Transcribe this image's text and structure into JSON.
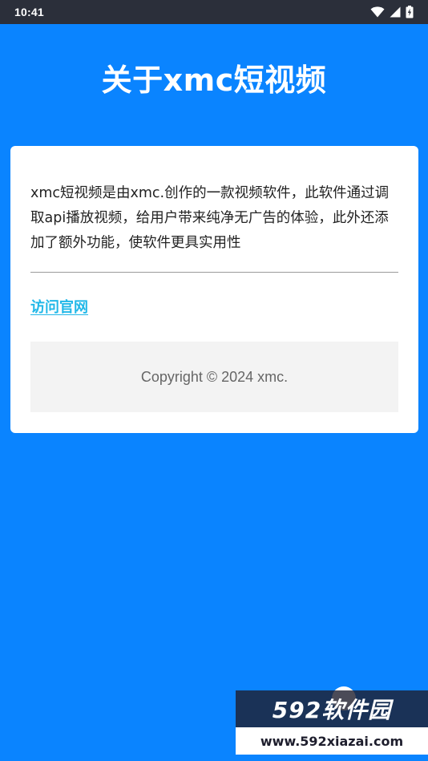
{
  "status_bar": {
    "time": "10:41",
    "icons": [
      "wifi-icon",
      "signal-icon",
      "battery-charging-icon"
    ]
  },
  "header": {
    "title": "关于xmc短视频"
  },
  "card": {
    "description": "xmc短视频是由xmc.创作的一款视频软件，此软件通过调取api播放视频，给用户带来纯净无广告的体验，此外还添加了额外功能，使软件更具实用性",
    "visit_link": "访问官网",
    "copyright": "Copyright © 2024 xmc."
  },
  "watermark": {
    "brand": "592软件园",
    "url": "www.592xiazai.com"
  },
  "colors": {
    "background": "#0a84ff",
    "status_bar": "#2b2f3a",
    "link": "#22b8e8",
    "copyright_box": "#f3f3f3"
  }
}
